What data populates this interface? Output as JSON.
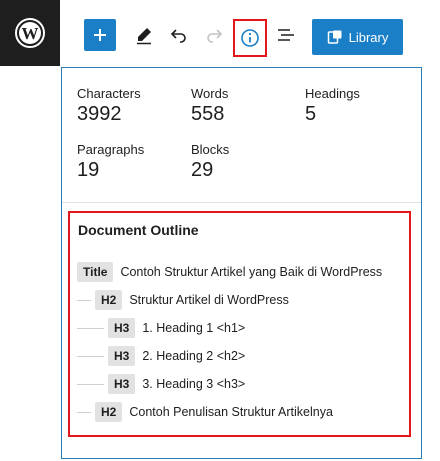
{
  "toolbar": {
    "library_label": "Library"
  },
  "stats": [
    {
      "label": "Characters",
      "value": "3992"
    },
    {
      "label": "Words",
      "value": "558"
    },
    {
      "label": "Headings",
      "value": "5"
    },
    {
      "label": "Paragraphs",
      "value": "19"
    },
    {
      "label": "Blocks",
      "value": "29"
    }
  ],
  "outline": {
    "title": "Document Outline",
    "items": [
      {
        "badge": "Title",
        "text": "Contoh Struktur Artikel yang Baik di WordPress"
      },
      {
        "badge": "H2",
        "text": "Struktur Artikel di WordPress"
      },
      {
        "badge": "H3",
        "text": "1. Heading 1 <h1>"
      },
      {
        "badge": "H3",
        "text": "2. Heading 2 <h2>"
      },
      {
        "badge": "H3",
        "text": "3. Heading 3 <h3>"
      },
      {
        "badge": "H2",
        "text": "Contoh Penulisan Struktur Artikelnya"
      }
    ]
  },
  "colors": {
    "accent": "#1a7fc7",
    "highlight_border": "#e3161b",
    "logo_bg": "#1e1e1e"
  },
  "icons": [
    "wordpress-icon",
    "plus-icon",
    "pencil-icon",
    "undo-icon",
    "redo-icon",
    "info-icon",
    "list-view-icon",
    "library-icon"
  ]
}
